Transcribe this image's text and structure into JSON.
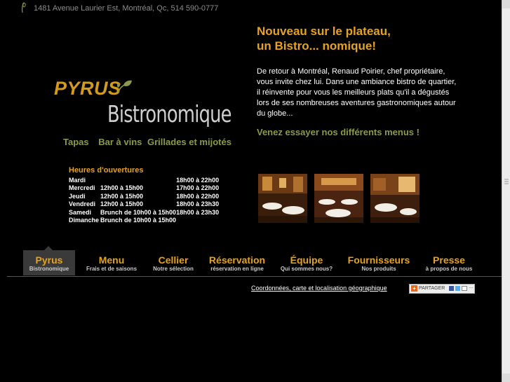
{
  "header": {
    "address": "1481 Avenue Laurier Est, Montréal, Qc, 514 590-0777"
  },
  "headline": {
    "line1": "Nouveau sur le plateau,",
    "line2": "un Bistro... nomique!"
  },
  "intro_text": "De retour à Montréal, Renaud Poirier, chef propriétaire, vous invite chez lui. Dans une ambiance bistro de quartier, il réinvente pour vous les meilleurs plats qu'il a dégustés lors de ses nombreuses aventures gastronomiques autour du globe...",
  "invite_text": "Venez essayer nos différents menus !",
  "logo": {
    "brand": "PYRUS",
    "subtitle": "Bistronomique"
  },
  "tagline": [
    "Tapas",
    "Bar à vins",
    "Grillades et mijotés"
  ],
  "hours": {
    "title": "Heures d'ouvertures",
    "rows": [
      {
        "day": "Mardi",
        "lunch": "",
        "dinner": "18h00 à 22h00"
      },
      {
        "day": "Mercredi",
        "lunch": "12h00 à 15h00",
        "dinner": "17h00 à 22h00"
      },
      {
        "day": "Jeudi",
        "lunch": "12h00 à 15h00",
        "dinner": "18h00 à 22h00"
      },
      {
        "day": "Vendredi",
        "lunch": "12h00 à 15h00",
        "dinner": "18h00 à 23h30"
      },
      {
        "day": "Samedi",
        "lunch": "Brunch de 10h00 à 15h00",
        "dinner": "18h00 à 23h30"
      },
      {
        "day": "Dimanche",
        "lunch": "Brunch de 10h00 à 15h00",
        "dinner": ""
      }
    ]
  },
  "nav": [
    {
      "title": "Pyrus",
      "sub": "Bistronomique",
      "active": true
    },
    {
      "title": "Menu",
      "sub": "Frais et de saisons",
      "active": false
    },
    {
      "title": "Cellier",
      "sub": "Notre sélection",
      "active": false
    },
    {
      "title": "Réservation",
      "sub": "réservation en ligne",
      "active": false
    },
    {
      "title": "Équipe",
      "sub": "Qui sommes nous?",
      "active": false
    },
    {
      "title": "Fournisseurs",
      "sub": "Nos produits",
      "active": false
    },
    {
      "title": "Presse",
      "sub": "à propos de nous",
      "active": false
    }
  ],
  "footer": {
    "coords_link": "Coordonnées, carte et localisation géographique",
    "share_label": "PARTAGER"
  },
  "colors": {
    "accent_orange": "#e8a21c",
    "accent_olive": "#8a9a4a",
    "background": "#000000"
  },
  "icons": [
    "leaf-mark-icon",
    "pyrus-leaf-icon",
    "share-plus-icon",
    "facebook-icon",
    "twitter-icon",
    "email-icon"
  ]
}
